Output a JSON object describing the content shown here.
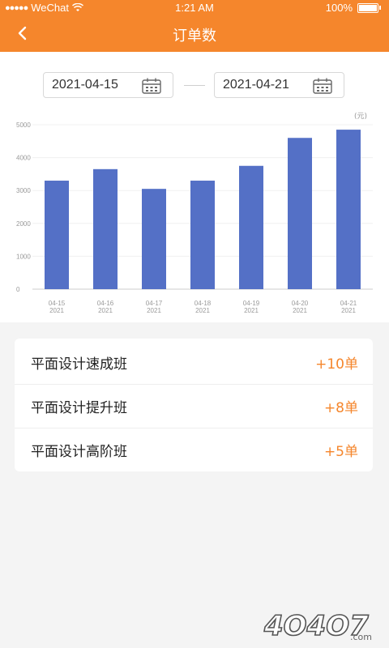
{
  "status_bar": {
    "carrier": "WeChat",
    "time": "1:21 AM",
    "battery": "100%"
  },
  "nav": {
    "title": "订单数"
  },
  "date_range": {
    "start": "2021-04-15",
    "end": "2021-04-21"
  },
  "chart_data": {
    "type": "bar",
    "categories": [
      "04-15\n2021",
      "04-16\n2021",
      "04-17\n2021",
      "04-18\n2021",
      "04-19\n2021",
      "04-20\n2021",
      "04-21\n2021"
    ],
    "category_lines": [
      [
        "04-15",
        "2021"
      ],
      [
        "04-16",
        "2021"
      ],
      [
        "04-17",
        "2021"
      ],
      [
        "04-18",
        "2021"
      ],
      [
        "04-19",
        "2021"
      ],
      [
        "04-20",
        "2021"
      ],
      [
        "04-21",
        "2021"
      ]
    ],
    "values": [
      3300,
      3650,
      3050,
      3300,
      3750,
      4600,
      4850
    ],
    "y_ticks": [
      0,
      1000,
      2000,
      3000,
      4000,
      5000
    ],
    "ylim": [
      0,
      5000
    ],
    "unit_label": "(元)",
    "grid": true,
    "bar_color": "#5470c6"
  },
  "courses": [
    {
      "name": "平面设计速成班",
      "value": "+10单"
    },
    {
      "name": "平面设计提升班",
      "value": "+8单"
    },
    {
      "name": "平面设计高阶班",
      "value": "+5单"
    }
  ],
  "watermark": {
    "text": "4O4O7",
    "suffix": ".com"
  },
  "colors": {
    "accent": "#f5862c",
    "bar": "#5470c6",
    "background": "#f4f4f4"
  },
  "icons": {
    "back": "chevron-left-icon",
    "calendar": "calendar-icon",
    "wifi": "wifi-icon",
    "battery": "battery-icon"
  }
}
